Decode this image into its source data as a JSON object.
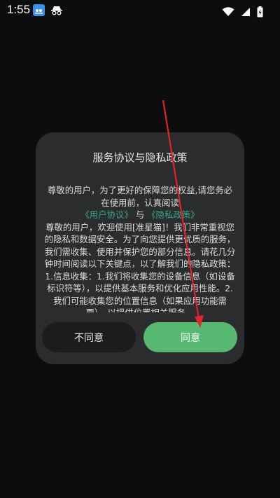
{
  "status_bar": {
    "time": "1:55",
    "icons": [
      "app-notification-icon",
      "incognito-icon",
      "wifi-icon",
      "signal-icon",
      "battery-charging-icon"
    ]
  },
  "dialog": {
    "title": "服务协议与隐私政策",
    "intro": "尊敬的用户，为了更好的保障您的权益,请您务必在使用前，认真阅读",
    "link_user_agreement": "《用户协议》",
    "connector": "与",
    "link_privacy_policy": "《隐私政策》",
    "body": "尊敬的用户，欢迎使用[准星猫]！我们非常重视您的隐私和数据安全。为了向您提供更优质的服务，我们需收集、使用并保护您的部分信息。请花几分钟时间阅读以下关键点，以了解我们的隐私政策：1.信息收集：1.我们将收集您的设备信息（如设备标识符等），以提供基本服务和优化应用性能。2.我们可能收集您的位置信息（如果应用功能需要），以提供位置相关服务。",
    "decline_label": "不同意",
    "agree_label": "同意"
  },
  "colors": {
    "background": "#0d0d0d",
    "dialog_bg": "#2b2c2e",
    "link": "#3aa58b",
    "agree_button": "#57b871",
    "decline_button": "#1c1c1d",
    "annotation_arrow": "#e0262b"
  }
}
